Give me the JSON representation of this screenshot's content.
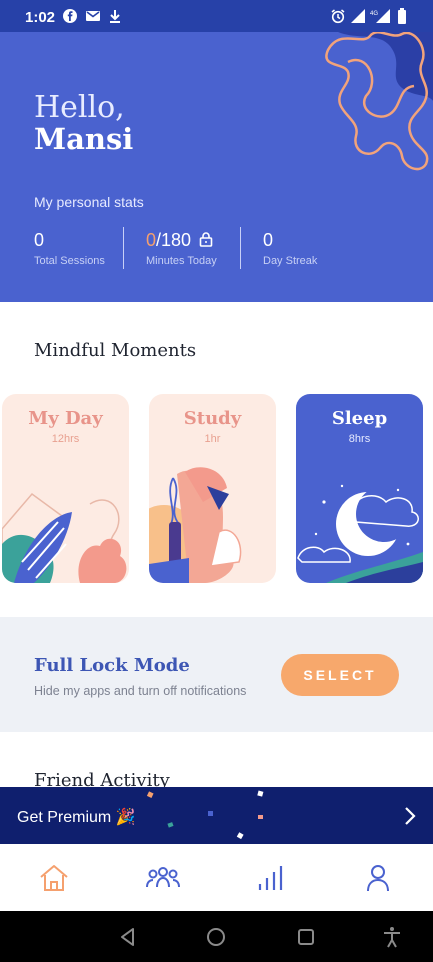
{
  "status_bar": {
    "time": "1:02",
    "left_icons": [
      "facebook-icon",
      "gmail-icon",
      "download-icon"
    ],
    "right_icons": [
      "alarm-icon",
      "signal-icon",
      "network-4g-icon",
      "battery-icon"
    ],
    "network_label": "4G"
  },
  "header": {
    "greeting": "Hello,",
    "name": "Mansi",
    "stats_label": "My personal stats",
    "stats": [
      {
        "value": "0",
        "label": "Total Sessions"
      },
      {
        "value_current": "0",
        "value_total": "/180",
        "label": "Minutes Today",
        "icon": "lock-icon"
      },
      {
        "value": "0",
        "label": "Day Streak"
      }
    ]
  },
  "mindful": {
    "title": "Mindful Moments",
    "cards": [
      {
        "title": "My Day",
        "subtitle": "12hrs"
      },
      {
        "title": "Study",
        "subtitle": "1hr"
      },
      {
        "title": "Sleep",
        "subtitle": "8hrs"
      }
    ]
  },
  "lock_mode": {
    "title": "Full Lock Mode",
    "subtitle": "Hide my apps and turn off notifications",
    "button_label": "SELECT"
  },
  "friend_activity": {
    "title": "Friend Activity"
  },
  "premium": {
    "label": "Get Premium",
    "emoji": "🎉"
  },
  "bottom_nav": [
    {
      "name": "home",
      "icon": "home-icon",
      "active": true
    },
    {
      "name": "friends",
      "icon": "group-icon",
      "active": false
    },
    {
      "name": "stats",
      "icon": "bar-chart-icon",
      "active": false
    },
    {
      "name": "profile",
      "icon": "person-icon",
      "active": false
    }
  ],
  "colors": {
    "primary": "#4a62cf",
    "status_bar": "#2741a8",
    "accent": "#f7a86c",
    "premium_bg": "#0f1f6e",
    "lock_title": "#3d56b4"
  }
}
